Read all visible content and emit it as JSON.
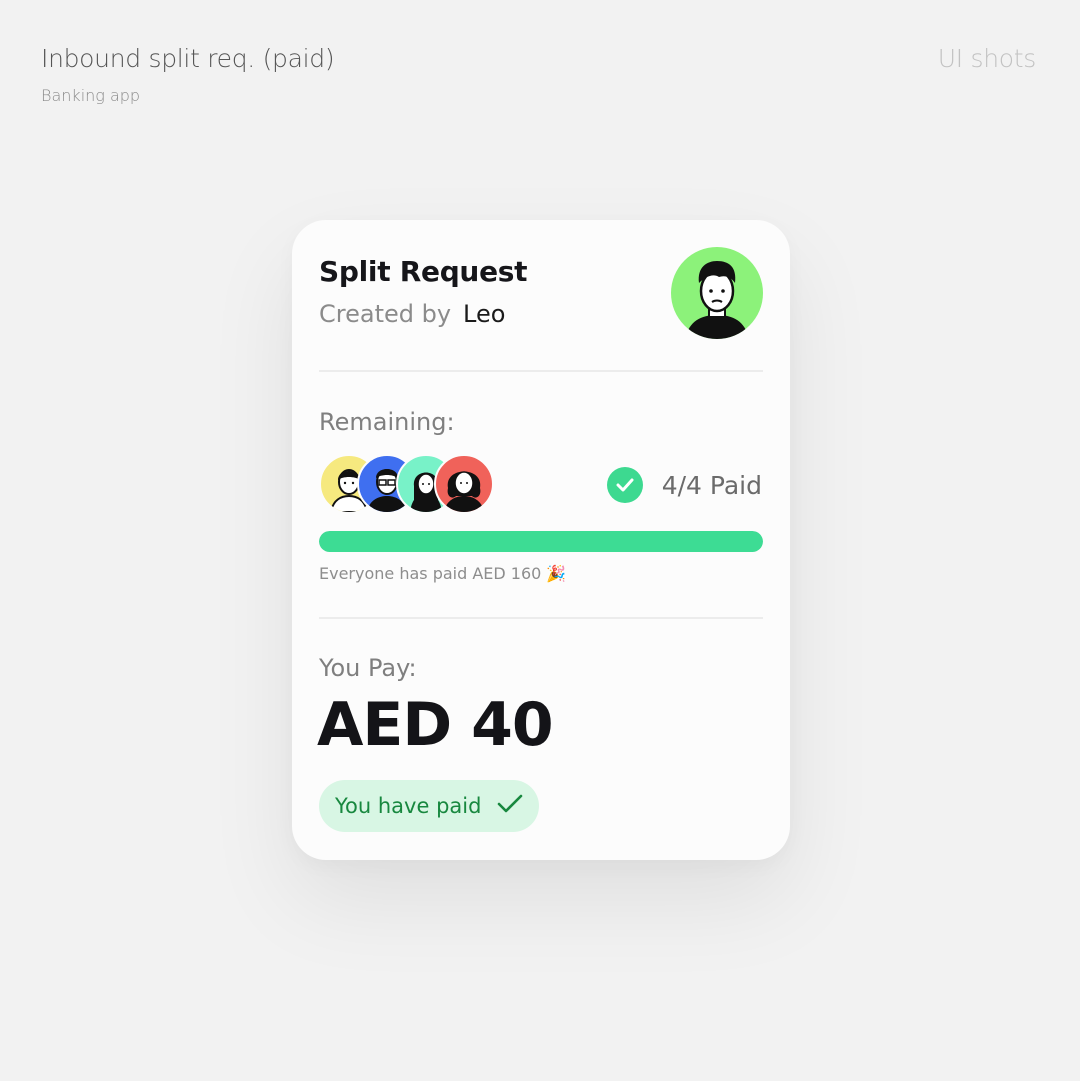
{
  "header": {
    "title": "Inbound split req. (paid)",
    "subtitle": "Banking app",
    "right_label": "UI shots"
  },
  "card": {
    "title": "Split Request",
    "created_by_label": "Created by",
    "creator_name": "Leo",
    "creator_avatar_icon": "person-avatar-icon",
    "remaining_label": "Remaining:",
    "participants": [
      {
        "avatar_icon": "person-avatar-icon",
        "color": "#f6e97f"
      },
      {
        "avatar_icon": "person-avatar-icon",
        "color": "#3f6ff0"
      },
      {
        "avatar_icon": "person-avatar-icon",
        "color": "#78f2c8"
      },
      {
        "avatar_icon": "person-avatar-icon",
        "color": "#f0625a"
      }
    ],
    "paid_status": "4/4 Paid",
    "paid_icon": "check-circle-icon",
    "progress_fraction": 1.0,
    "progress_note": "Everyone has paid AED 160 🎉",
    "you_pay_label": "You Pay:",
    "amount": "AED 40",
    "badge_text": "You have paid",
    "badge_icon": "check-icon"
  },
  "colors": {
    "accent_green": "#3ddc94",
    "badge_bg": "#d8f6e4",
    "badge_text": "#18883f",
    "creator_avatar_bg": "#8cf27a"
  }
}
